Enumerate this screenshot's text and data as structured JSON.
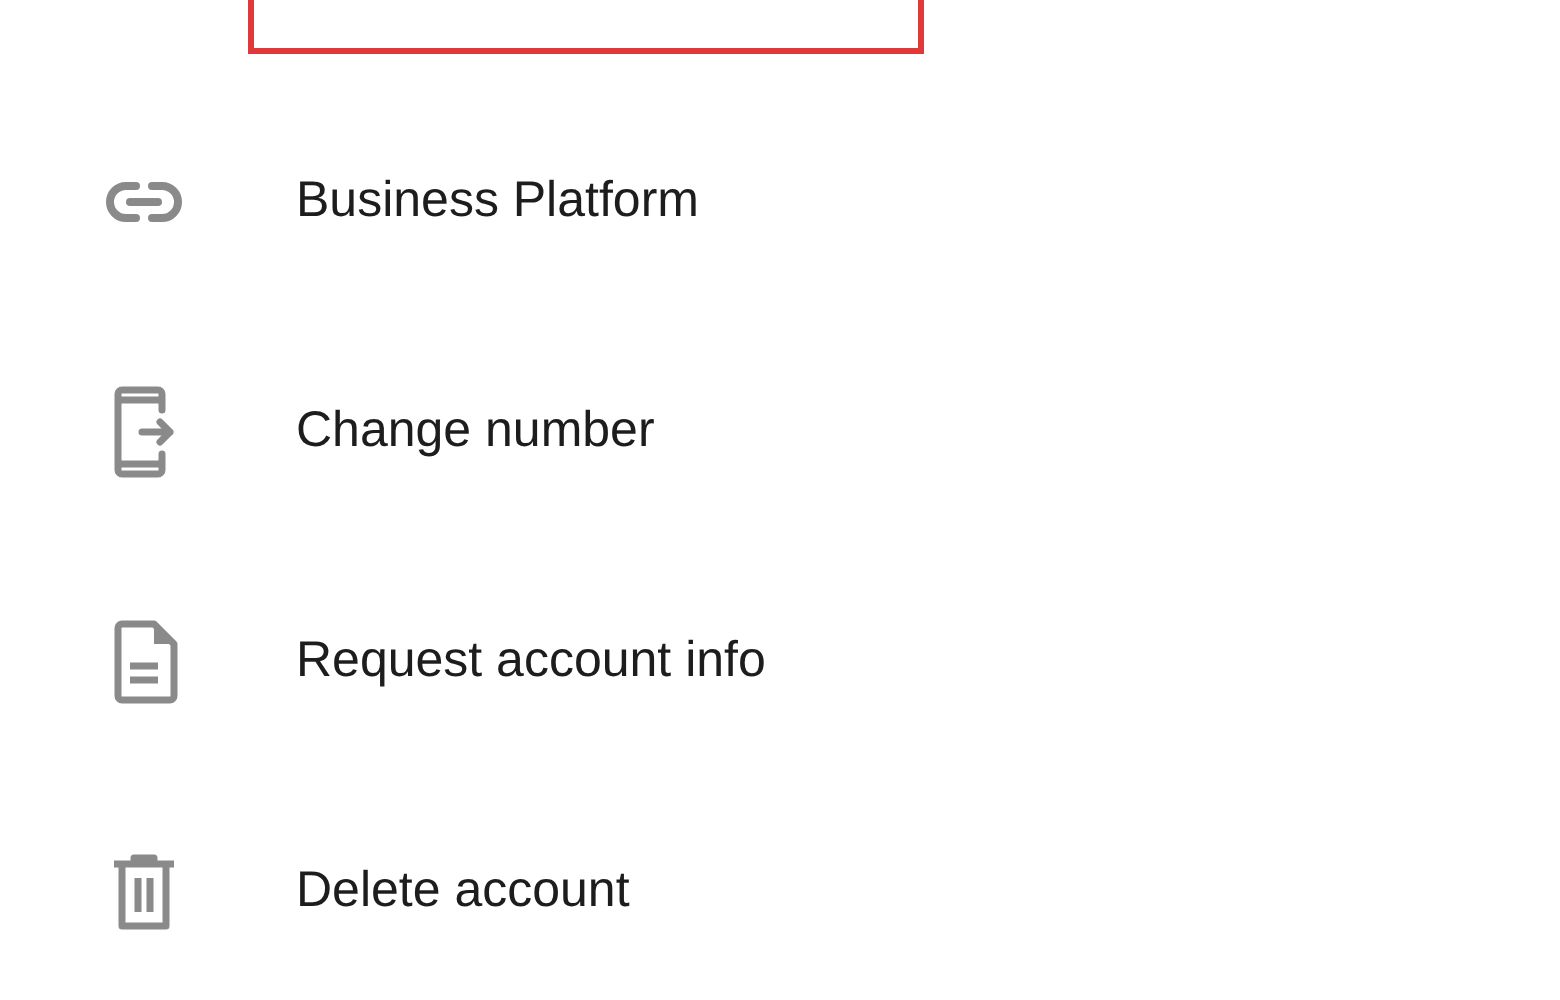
{
  "highlight": {
    "shown": true
  },
  "items": [
    {
      "label": "Business Platform"
    },
    {
      "label": "Change number"
    },
    {
      "label": "Request account info"
    },
    {
      "label": "Delete account"
    }
  ]
}
